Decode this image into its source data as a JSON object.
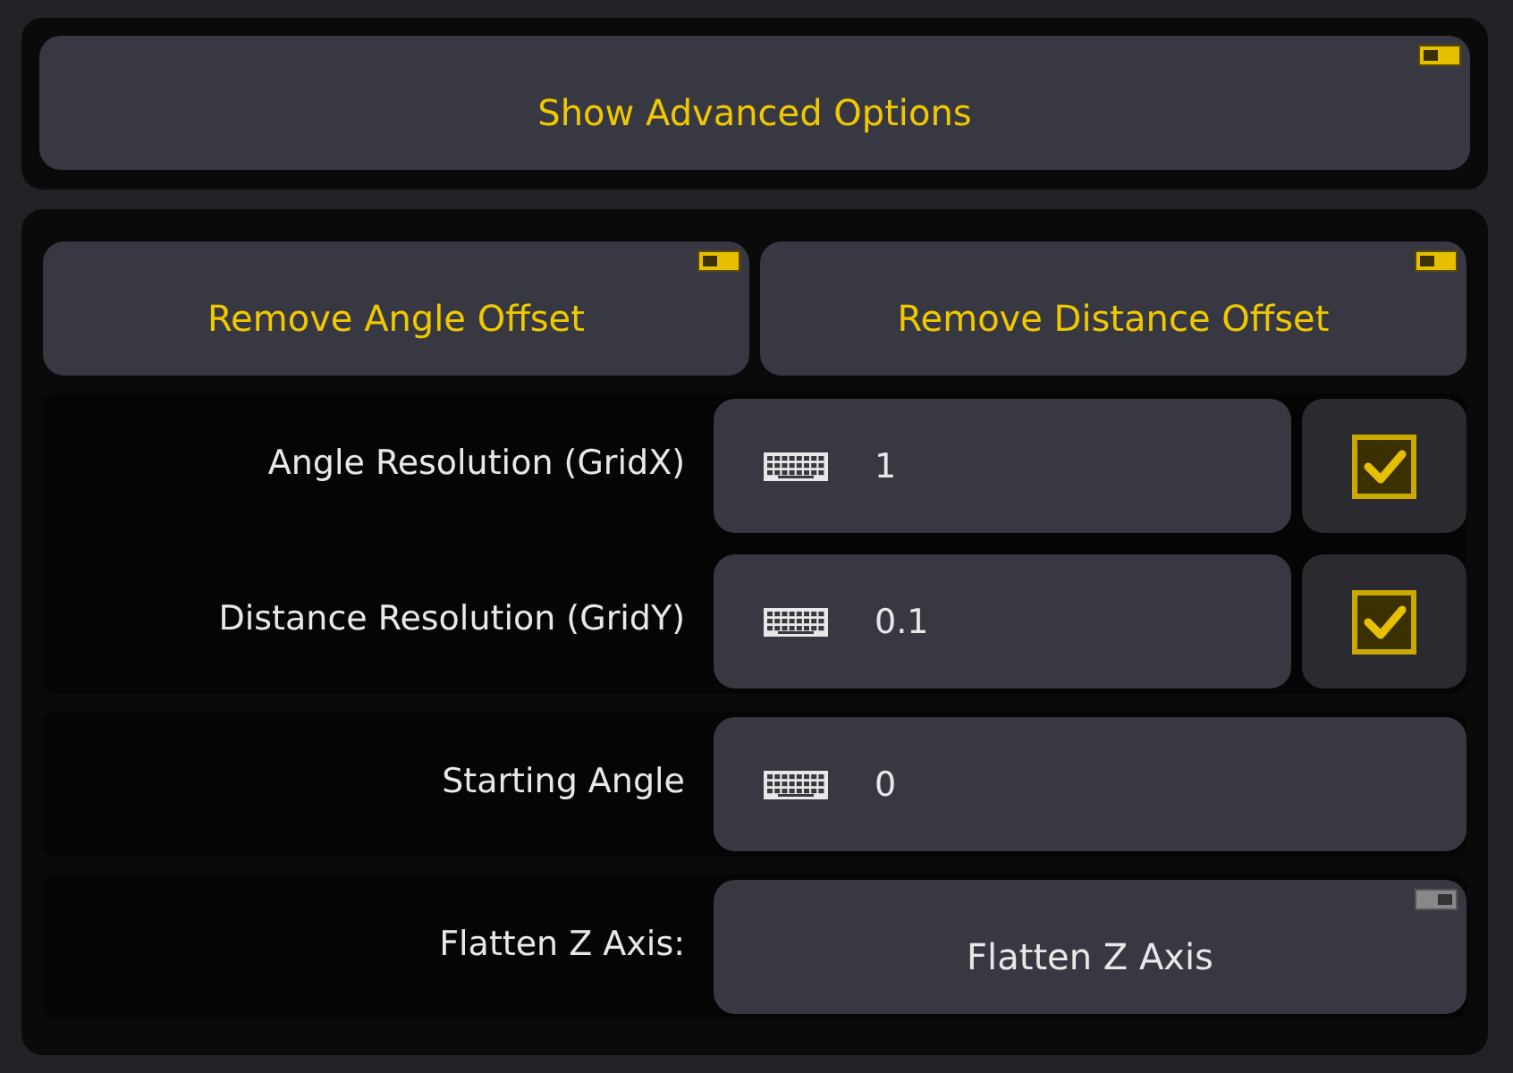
{
  "advanced_toggle": {
    "label": "Show Advanced Options",
    "on": true
  },
  "offset_buttons": [
    {
      "label": "Remove Angle Offset",
      "on": true
    },
    {
      "label": "Remove Distance Offset",
      "on": true
    }
  ],
  "sections": [
    {
      "rows": [
        {
          "kind": "input",
          "label": "Angle Resolution (GridX)",
          "value": "1",
          "checked": true
        },
        {
          "kind": "input",
          "label": "Distance Resolution (GridY)",
          "value": "0.1",
          "checked": true
        }
      ]
    },
    {
      "rows": [
        {
          "kind": "input",
          "label": "Starting Angle",
          "value": "0"
        }
      ]
    },
    {
      "rows": [
        {
          "kind": "toggle",
          "label": "Flatten Z Axis:",
          "button": "Flatten Z Axis",
          "on": false
        }
      ]
    }
  ]
}
